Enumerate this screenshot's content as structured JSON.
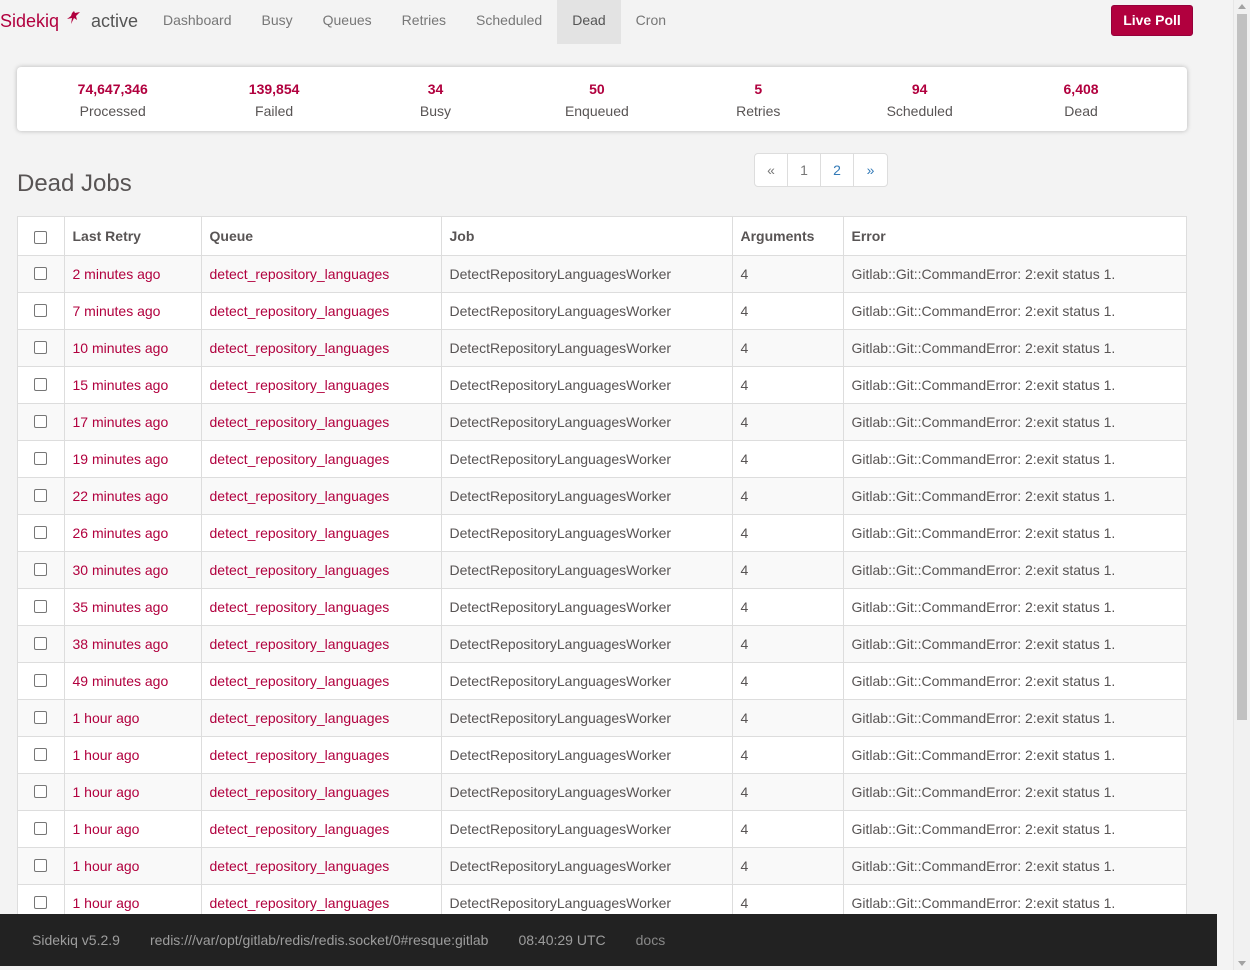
{
  "brand": {
    "name": "Sidekiq",
    "status": "active"
  },
  "nav": {
    "items": [
      {
        "label": "Dashboard",
        "active": false
      },
      {
        "label": "Busy",
        "active": false
      },
      {
        "label": "Queues",
        "active": false
      },
      {
        "label": "Retries",
        "active": false
      },
      {
        "label": "Scheduled",
        "active": false
      },
      {
        "label": "Dead",
        "active": true
      },
      {
        "label": "Cron",
        "active": false
      }
    ],
    "live_poll_label": "Live Poll"
  },
  "summary": [
    {
      "count": "74,647,346",
      "label": "Processed"
    },
    {
      "count": "139,854",
      "label": "Failed"
    },
    {
      "count": "34",
      "label": "Busy"
    },
    {
      "count": "50",
      "label": "Enqueued"
    },
    {
      "count": "5",
      "label": "Retries"
    },
    {
      "count": "94",
      "label": "Scheduled"
    },
    {
      "count": "6,408",
      "label": "Dead"
    }
  ],
  "page_title": "Dead Jobs",
  "pagination": {
    "prev": "«",
    "pages": [
      "1",
      "2"
    ],
    "next": "»",
    "current": "1"
  },
  "table": {
    "headers": [
      "Last Retry",
      "Queue",
      "Job",
      "Arguments",
      "Error"
    ],
    "rows": [
      {
        "retry": "2 minutes ago",
        "queue": "detect_repository_languages",
        "job": "DetectRepositoryLanguagesWorker",
        "args": "4",
        "error": "Gitlab::Git::CommandError: 2:exit status 1."
      },
      {
        "retry": "7 minutes ago",
        "queue": "detect_repository_languages",
        "job": "DetectRepositoryLanguagesWorker",
        "args": "4",
        "error": "Gitlab::Git::CommandError: 2:exit status 1."
      },
      {
        "retry": "10 minutes ago",
        "queue": "detect_repository_languages",
        "job": "DetectRepositoryLanguagesWorker",
        "args": "4",
        "error": "Gitlab::Git::CommandError: 2:exit status 1."
      },
      {
        "retry": "15 minutes ago",
        "queue": "detect_repository_languages",
        "job": "DetectRepositoryLanguagesWorker",
        "args": "4",
        "error": "Gitlab::Git::CommandError: 2:exit status 1."
      },
      {
        "retry": "17 minutes ago",
        "queue": "detect_repository_languages",
        "job": "DetectRepositoryLanguagesWorker",
        "args": "4",
        "error": "Gitlab::Git::CommandError: 2:exit status 1."
      },
      {
        "retry": "19 minutes ago",
        "queue": "detect_repository_languages",
        "job": "DetectRepositoryLanguagesWorker",
        "args": "4",
        "error": "Gitlab::Git::CommandError: 2:exit status 1."
      },
      {
        "retry": "22 minutes ago",
        "queue": "detect_repository_languages",
        "job": "DetectRepositoryLanguagesWorker",
        "args": "4",
        "error": "Gitlab::Git::CommandError: 2:exit status 1."
      },
      {
        "retry": "26 minutes ago",
        "queue": "detect_repository_languages",
        "job": "DetectRepositoryLanguagesWorker",
        "args": "4",
        "error": "Gitlab::Git::CommandError: 2:exit status 1."
      },
      {
        "retry": "30 minutes ago",
        "queue": "detect_repository_languages",
        "job": "DetectRepositoryLanguagesWorker",
        "args": "4",
        "error": "Gitlab::Git::CommandError: 2:exit status 1."
      },
      {
        "retry": "35 minutes ago",
        "queue": "detect_repository_languages",
        "job": "DetectRepositoryLanguagesWorker",
        "args": "4",
        "error": "Gitlab::Git::CommandError: 2:exit status 1."
      },
      {
        "retry": "38 minutes ago",
        "queue": "detect_repository_languages",
        "job": "DetectRepositoryLanguagesWorker",
        "args": "4",
        "error": "Gitlab::Git::CommandError: 2:exit status 1."
      },
      {
        "retry": "49 minutes ago",
        "queue": "detect_repository_languages",
        "job": "DetectRepositoryLanguagesWorker",
        "args": "4",
        "error": "Gitlab::Git::CommandError: 2:exit status 1."
      },
      {
        "retry": "1 hour ago",
        "queue": "detect_repository_languages",
        "job": "DetectRepositoryLanguagesWorker",
        "args": "4",
        "error": "Gitlab::Git::CommandError: 2:exit status 1."
      },
      {
        "retry": "1 hour ago",
        "queue": "detect_repository_languages",
        "job": "DetectRepositoryLanguagesWorker",
        "args": "4",
        "error": "Gitlab::Git::CommandError: 2:exit status 1."
      },
      {
        "retry": "1 hour ago",
        "queue": "detect_repository_languages",
        "job": "DetectRepositoryLanguagesWorker",
        "args": "4",
        "error": "Gitlab::Git::CommandError: 2:exit status 1."
      },
      {
        "retry": "1 hour ago",
        "queue": "detect_repository_languages",
        "job": "DetectRepositoryLanguagesWorker",
        "args": "4",
        "error": "Gitlab::Git::CommandError: 2:exit status 1."
      },
      {
        "retry": "1 hour ago",
        "queue": "detect_repository_languages",
        "job": "DetectRepositoryLanguagesWorker",
        "args": "4",
        "error": "Gitlab::Git::CommandError: 2:exit status 1."
      },
      {
        "retry": "1 hour ago",
        "queue": "detect_repository_languages",
        "job": "DetectRepositoryLanguagesWorker",
        "args": "4",
        "error": "Gitlab::Git::CommandError: 2:exit status 1."
      }
    ]
  },
  "footer": {
    "version": "Sidekiq v5.2.9",
    "redis": "redis:///var/opt/gitlab/redis/redis.socket/0#resque:gitlab",
    "time": "08:40:29 UTC",
    "docs": "docs"
  },
  "colors": {
    "accent": "#b1003e",
    "footer_bg": "#222222",
    "link": "#337ab7"
  },
  "icons": {
    "brand": "sidekiq-ninja-icon"
  }
}
